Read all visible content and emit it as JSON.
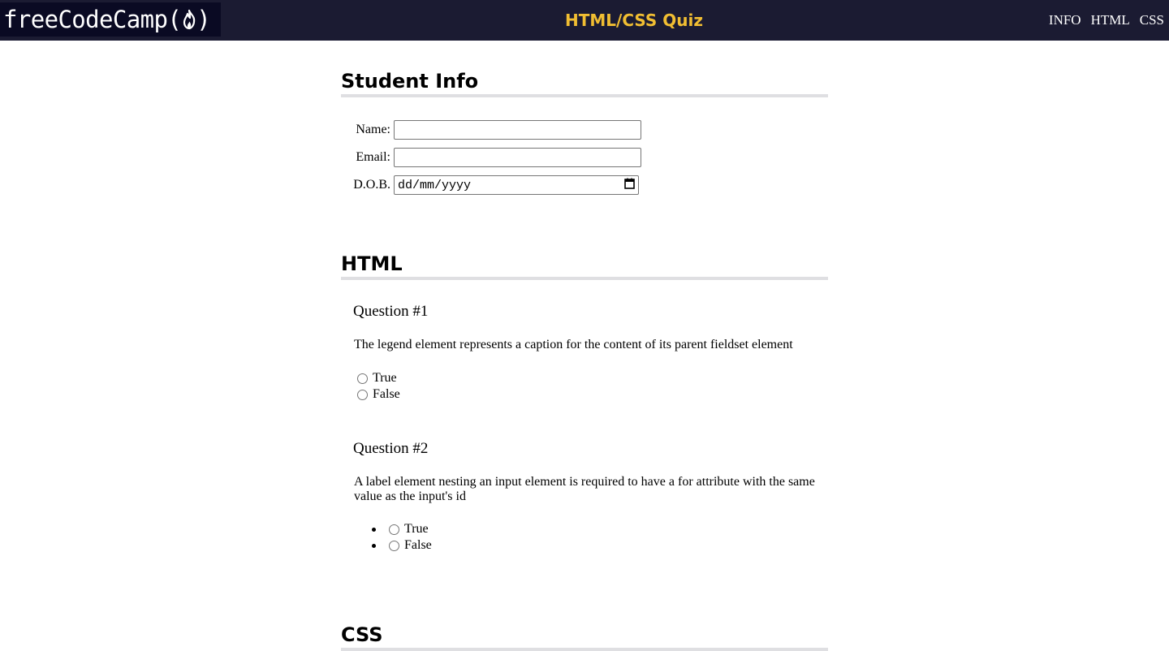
{
  "header": {
    "logo_text": "freeCodeCamp(",
    "logo_close": ")",
    "title": "HTML/CSS Quiz",
    "nav": [
      "INFO",
      "HTML",
      "CSS"
    ],
    "colors": {
      "bar": "#1b1b32",
      "logo_bg": "#0a0a23",
      "title": "#f1be32"
    }
  },
  "student_info": {
    "heading": "Student Info",
    "name_label": "Name:",
    "name_value": "",
    "email_label": "Email:",
    "email_value": "",
    "dob_label": "D.O.B.",
    "dob_placeholder": "dd/mm/yyyy"
  },
  "html_section": {
    "heading": "HTML",
    "questions": [
      {
        "title": "Question #1",
        "text": "The legend element represents a caption for the content of its parent fieldset element",
        "options": [
          "True",
          "False"
        ]
      },
      {
        "title": "Question #2",
        "text": "A label element nesting an input element is required to have a for attribute with the same value as the input's id",
        "options": [
          "True",
          "False"
        ]
      }
    ]
  },
  "css_section": {
    "heading": "CSS"
  },
  "icons": {
    "flame": "flame-icon",
    "calendar": "calendar-icon"
  }
}
